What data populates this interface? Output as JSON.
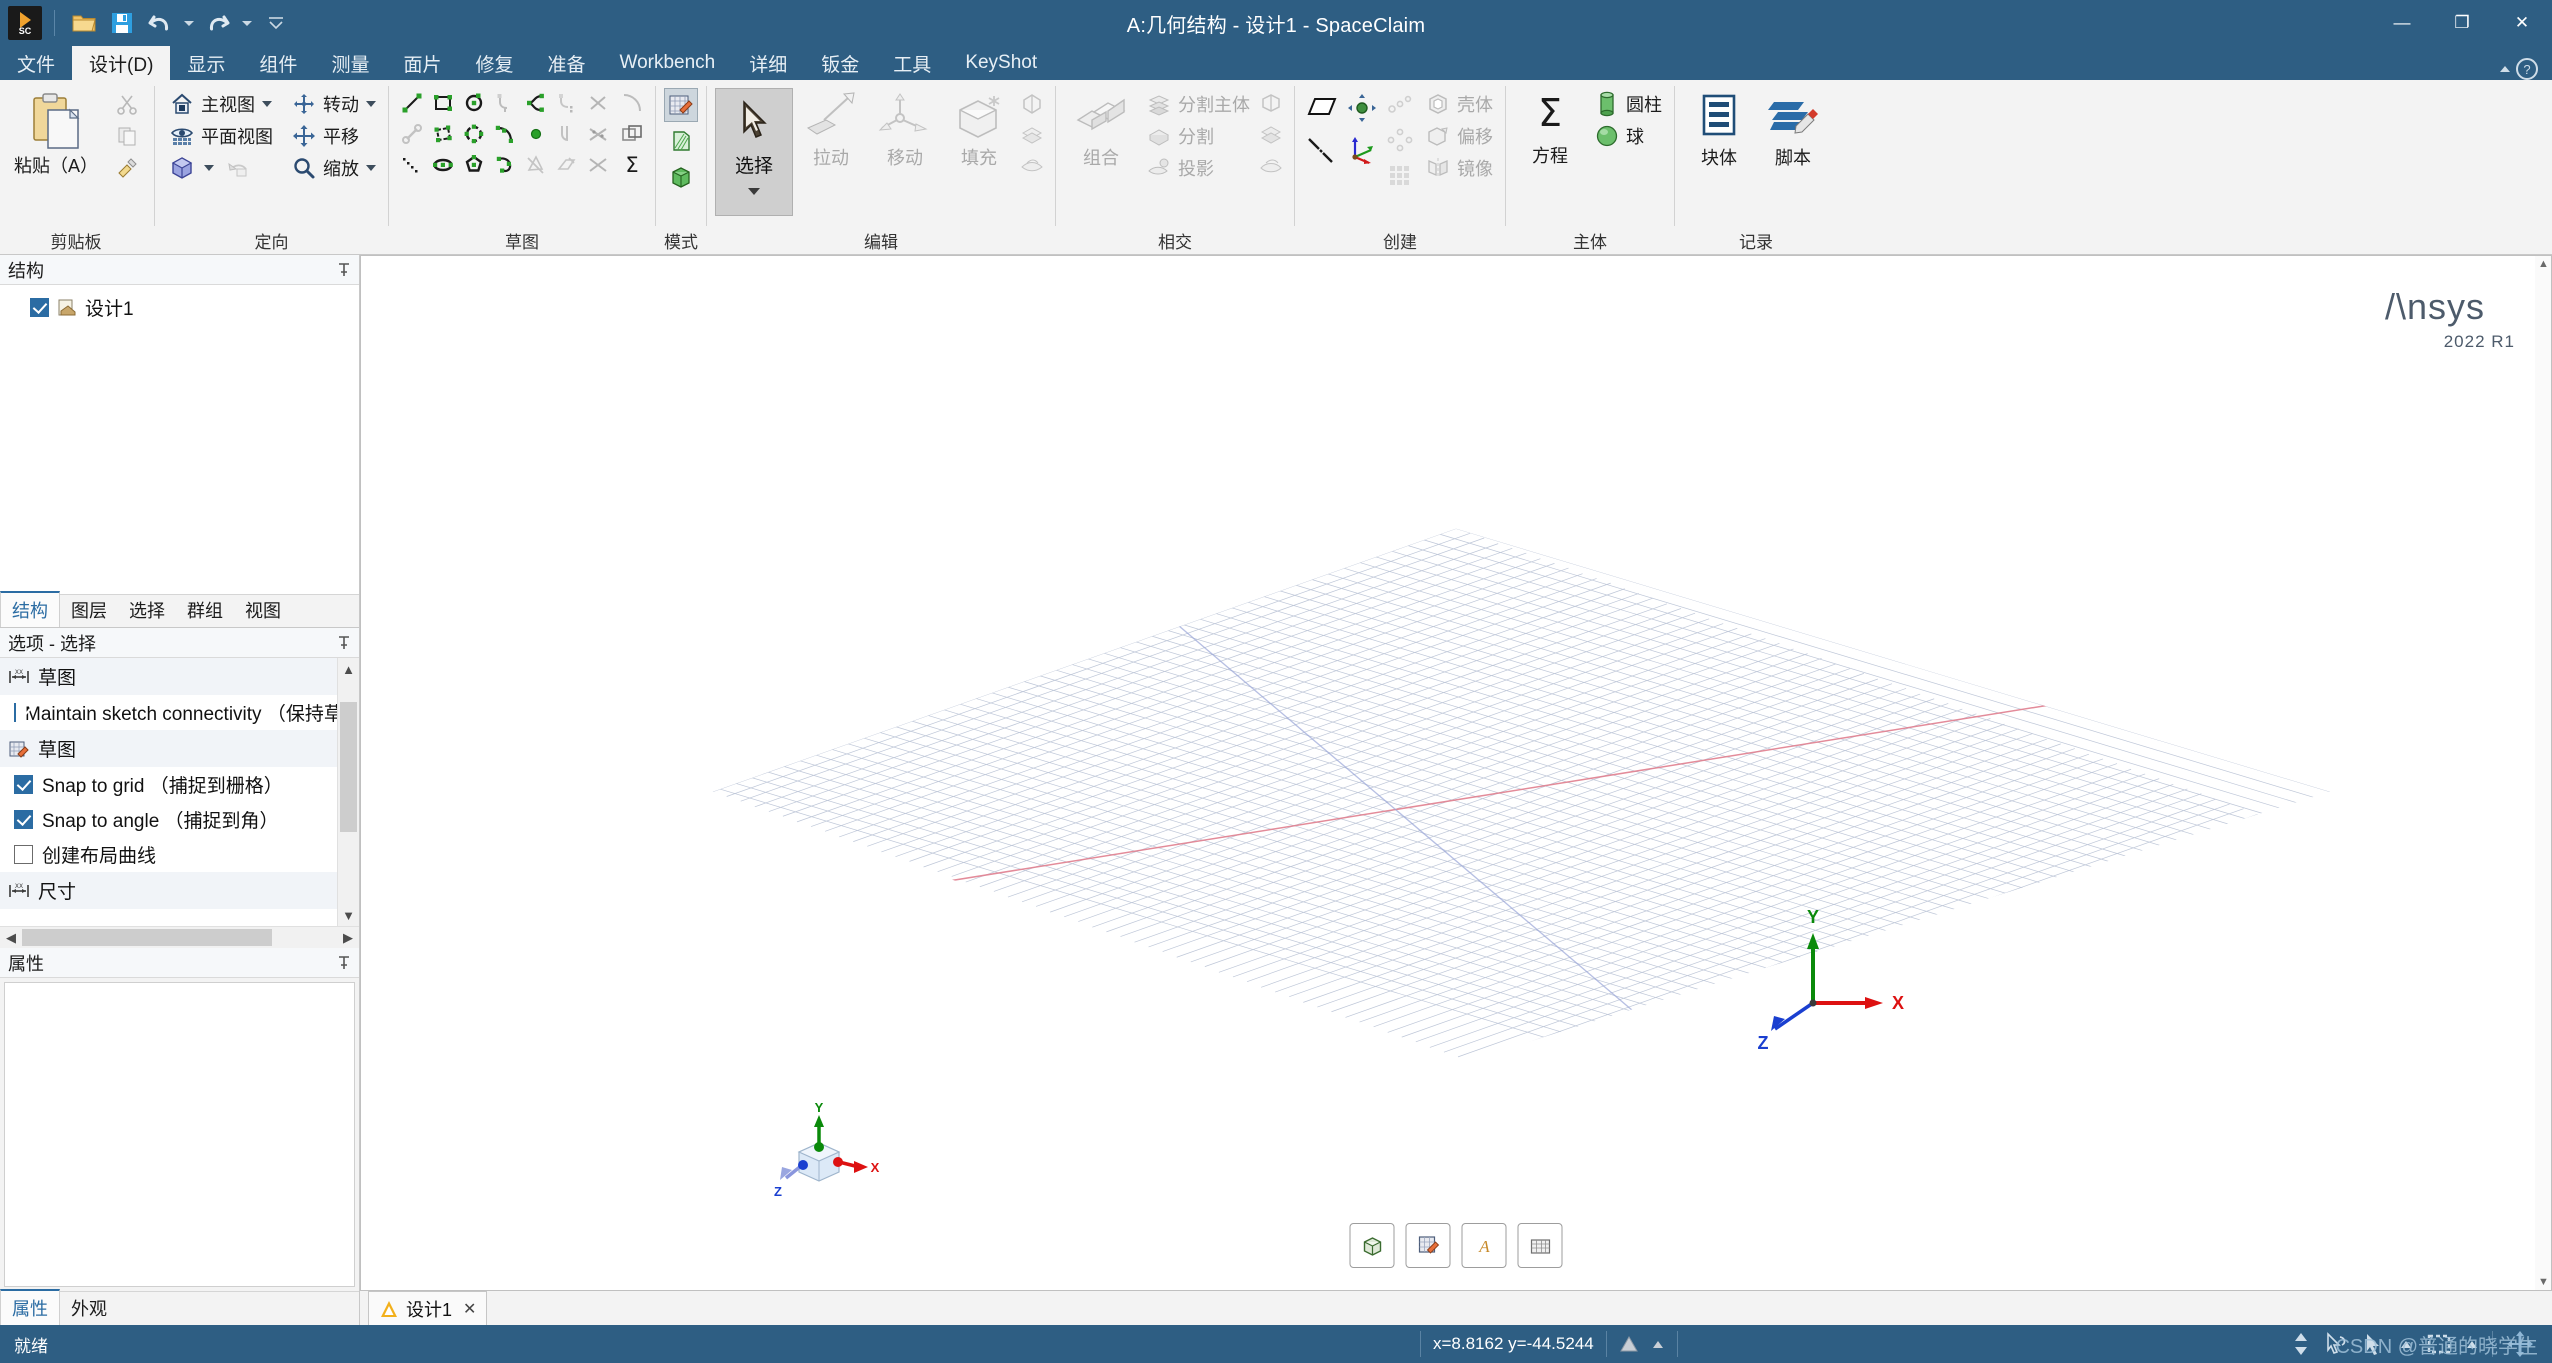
{
  "window": {
    "title": "A:几何结构 - 设计1 - SpaceClaim",
    "minimize_label": "—",
    "maximize_label": "❐",
    "close_label": "✕"
  },
  "quick_access": {
    "logo_text": "SC",
    "items": [
      {
        "name": "open-icon",
        "tooltip": "打开"
      },
      {
        "name": "save-icon",
        "tooltip": "保存"
      },
      {
        "name": "undo-icon",
        "tooltip": "撤消"
      },
      {
        "name": "redo-icon",
        "tooltip": "恢复"
      },
      {
        "name": "customize-icon",
        "tooltip": "自定义快速访问工具栏"
      }
    ]
  },
  "ribbon_tabs": [
    {
      "label": "文件",
      "active": false
    },
    {
      "label": "设计(D)",
      "active": true
    },
    {
      "label": "显示",
      "active": false
    },
    {
      "label": "组件",
      "active": false
    },
    {
      "label": "测量",
      "active": false
    },
    {
      "label": "面片",
      "active": false
    },
    {
      "label": "修复",
      "active": false
    },
    {
      "label": "准备",
      "active": false
    },
    {
      "label": "Workbench",
      "active": false
    },
    {
      "label": "详细",
      "active": false
    },
    {
      "label": "钣金",
      "active": false
    },
    {
      "label": "工具",
      "active": false
    },
    {
      "label": "KeyShot",
      "active": false
    }
  ],
  "ribbon": {
    "groups": {
      "clipboard": {
        "label": "剪贴板",
        "paste_label": "粘贴（A）",
        "small": [
          {
            "label": "",
            "icon": "cut-icon",
            "disabled": true
          },
          {
            "label": "",
            "icon": "copy-icon",
            "disabled": true
          },
          {
            "label": "",
            "icon": "format-painter-icon",
            "disabled": false
          }
        ]
      },
      "orient": {
        "label": "定向",
        "items": [
          {
            "label": "主视图",
            "icon": "home-view-icon",
            "dropdown": true,
            "disabled": false
          },
          {
            "label": "转动",
            "icon": "spin-icon",
            "dropdown": true,
            "disabled": false
          },
          {
            "label": "平面视图",
            "icon": "plan-view-icon",
            "dropdown": false,
            "disabled": false
          },
          {
            "label": "平移",
            "icon": "pan-icon",
            "dropdown": false,
            "disabled": false
          },
          {
            "label": "",
            "icon": "isometric-cube-icon",
            "dropdown": true,
            "disabled": false
          },
          {
            "label": "",
            "icon": "previous-view-icon",
            "dropdown": false,
            "disabled": true
          },
          {
            "label": "缩放",
            "icon": "zoom-icon",
            "dropdown": true,
            "disabled": false
          }
        ]
      },
      "sketch": {
        "label": "草图",
        "tools": [
          {
            "name": "line-icon",
            "disabled": false
          },
          {
            "name": "rectangle-icon",
            "disabled": false
          },
          {
            "name": "circle-icon",
            "disabled": false
          },
          {
            "name": "tangent-arc-icon",
            "disabled": true
          },
          {
            "name": "spline-icon",
            "disabled": false
          },
          {
            "name": "construction-line-icon",
            "disabled": true
          },
          {
            "name": "trim-away-icon",
            "disabled": true
          },
          {
            "name": "line-2point-icon",
            "disabled": true
          },
          {
            "name": "three-point-rect-icon",
            "disabled": false
          },
          {
            "name": "three-point-arc-icon",
            "disabled": false
          },
          {
            "name": "sweep-arc-icon",
            "disabled": false
          },
          {
            "name": "point-icon",
            "disabled": false
          },
          {
            "name": "corner-icon",
            "disabled": true
          },
          {
            "name": "split-curve-icon",
            "disabled": true
          },
          {
            "name": "polyline-icon",
            "disabled": false
          },
          {
            "name": "ellipse-icon",
            "disabled": false
          },
          {
            "name": "polygon-icon",
            "disabled": false
          },
          {
            "name": "arc-icon",
            "disabled": false
          },
          {
            "name": "create-edge-icon",
            "disabled": true
          },
          {
            "name": "project-to-sketch-icon",
            "disabled": true
          },
          {
            "name": "offset-curve-icon",
            "disabled": true
          }
        ],
        "extra": [
          {
            "name": "fillet-icon",
            "disabled": true
          },
          {
            "name": "offset-rect-icon",
            "disabled": true
          },
          {
            "name": "equation-sum-icon",
            "disabled": false
          }
        ]
      },
      "mode": {
        "label": "模式",
        "items": [
          {
            "name": "sketch-mode-icon",
            "selected": true
          },
          {
            "name": "section-mode-icon",
            "selected": false
          },
          {
            "name": "solid-mode-icon",
            "selected": false
          }
        ]
      },
      "edit": {
        "label": "编辑",
        "select_label": "选择",
        "items": [
          {
            "label": "拉动",
            "icon": "pull-icon",
            "disabled": true
          },
          {
            "label": "移动",
            "icon": "move-icon",
            "disabled": true
          },
          {
            "label": "填充",
            "icon": "fill-icon",
            "disabled": true
          }
        ],
        "small_icons": [
          {
            "name": "blend-icon",
            "disabled": true
          },
          {
            "name": "shell-small-icon",
            "disabled": true
          },
          {
            "name": "draft-icon",
            "disabled": true
          }
        ]
      },
      "intersect": {
        "label": "相交",
        "combine_label": "组合",
        "items": [
          {
            "label": "分割主体",
            "icon": "split-body-icon",
            "disabled": true
          },
          {
            "label": "分割",
            "icon": "split-icon",
            "disabled": true
          },
          {
            "label": "投影",
            "icon": "project-icon",
            "disabled": true
          }
        ],
        "small_icons": [
          {
            "name": "merge-faces-icon",
            "disabled": true
          },
          {
            "name": "split-face-icon",
            "disabled": true
          },
          {
            "name": "imprint-icon",
            "disabled": true
          }
        ]
      },
      "create": {
        "label": "创建",
        "items": [
          {
            "name": "plane-icon",
            "disabled": false
          },
          {
            "name": "axis-icon",
            "disabled": false
          },
          {
            "name": "origin-point-icon",
            "disabled": false
          },
          {
            "name": "coordinate-system-icon",
            "disabled": false
          },
          {
            "name": "linear-pattern-icon",
            "disabled": true
          },
          {
            "name": "circular-pattern-icon",
            "disabled": true
          },
          {
            "name": "fill-pattern-icon",
            "disabled": true
          }
        ],
        "labeled": [
          {
            "label": "壳体",
            "icon": "shell-icon",
            "disabled": true
          },
          {
            "label": "偏移",
            "icon": "offset-icon",
            "disabled": true
          },
          {
            "label": "镜像",
            "icon": "mirror-icon",
            "disabled": true
          }
        ]
      },
      "body": {
        "label": "主体",
        "equation_label": "方程",
        "items": [
          {
            "label": "圆柱",
            "icon": "cylinder-icon",
            "disabled": false
          },
          {
            "label": "球",
            "icon": "sphere-icon",
            "disabled": false
          }
        ]
      },
      "record": {
        "label": "记录",
        "items": [
          {
            "label": "块体",
            "icon": "block-recorder-icon"
          },
          {
            "label": "脚本",
            "icon": "script-icon"
          }
        ]
      }
    }
  },
  "left_panel": {
    "structure": {
      "title": "结构",
      "pin_icon": "pin-icon",
      "nodes": [
        {
          "label": "设计1",
          "checked": true,
          "icon": "design-document-icon"
        }
      ]
    },
    "panel_tabs": [
      {
        "label": "结构",
        "active": true
      },
      {
        "label": "图层",
        "active": false
      },
      {
        "label": "选择",
        "active": false
      },
      {
        "label": "群组",
        "active": false
      },
      {
        "label": "视图",
        "active": false
      }
    ],
    "options": {
      "title": "选项 - 选择",
      "pin_icon": "pin-icon",
      "sections": [
        {
          "header": "草图",
          "header_icon": "dimension-icon",
          "items": [
            {
              "label": "Maintain sketch connectivity （保持草图",
              "checked": true
            }
          ]
        },
        {
          "header": "草图",
          "header_icon": "sketch-pencil-icon",
          "items": [
            {
              "label": "Snap to grid （捕捉到栅格）",
              "checked": true
            },
            {
              "label": "Snap to angle （捕捉到角）",
              "checked": true
            },
            {
              "label": "创建布局曲线",
              "checked": false
            }
          ]
        },
        {
          "header": "尺寸",
          "header_icon": "dimension-icon",
          "items": []
        }
      ]
    },
    "properties": {
      "title": "属性",
      "pin_icon": "pin-icon",
      "tabs": [
        {
          "label": "属性",
          "active": true
        },
        {
          "label": "外观",
          "active": false
        }
      ]
    }
  },
  "viewport": {
    "brand_name": "Ansys",
    "brand_version": "2022 R1",
    "axes": {
      "x": "X",
      "y": "Y",
      "z": "Z"
    },
    "corner_triad": {
      "x": "X",
      "y": "Y",
      "z": "Z"
    },
    "view_tools": [
      {
        "name": "solid-display-icon"
      },
      {
        "name": "sketch-grid-icon"
      },
      {
        "name": "annotation-display-icon"
      },
      {
        "name": "mesh-display-icon"
      }
    ],
    "document_tabs": [
      {
        "label": "设计1",
        "icon": "ansys-doc-icon",
        "close_label": "✕",
        "active": true
      }
    ]
  },
  "statusbar": {
    "status_text": "就绪",
    "coordinates": "x=8.8162  y=-44.5244",
    "warning_icon": "warning-triangle-icon",
    "right_icons": [
      {
        "name": "spinner-updown-icon"
      },
      {
        "name": "select-back-icon"
      },
      {
        "name": "select-arrow-icon"
      },
      {
        "name": "select-arrow-dropdown-icon"
      },
      {
        "name": "box-select-icon"
      },
      {
        "name": "box-select-dropdown-icon"
      },
      {
        "name": "move-tool-icon"
      }
    ],
    "watermark": "CSDN @普通的晓学生"
  },
  "colors": {
    "titlebar": "#2e5e83",
    "ribbon_bg": "#f3f3f3",
    "accent": "#2b6ca3",
    "axis_x": "#dd1111",
    "axis_y": "#0a8a0a",
    "axis_z": "#1a3fd0",
    "grid": "#b9c3d4"
  }
}
